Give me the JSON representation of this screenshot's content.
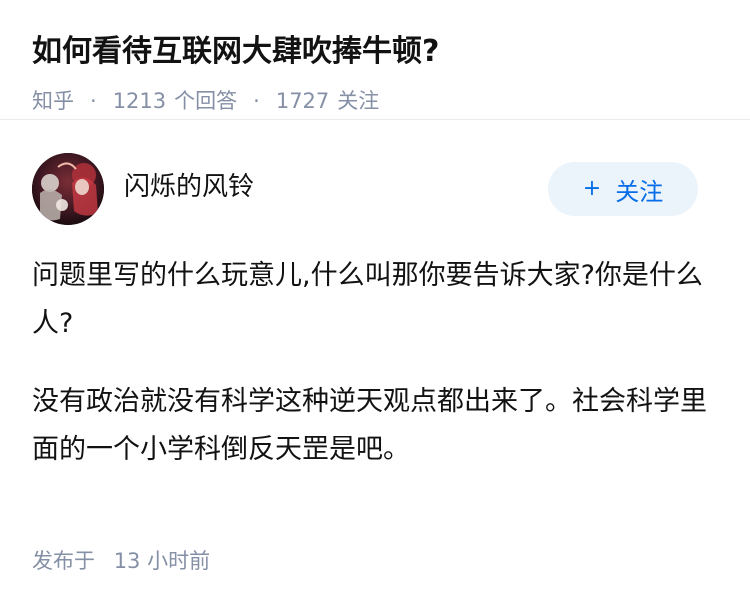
{
  "question": {
    "title": "如何看待互联网大肆吹捧牛顿?",
    "source": "知乎",
    "answer_count": "1213",
    "answer_label": "个回答",
    "follower_count": "1727",
    "follower_label": "关注",
    "separator": "·"
  },
  "answer": {
    "author_name": "闪烁的风铃",
    "follow_button": {
      "plus": "+",
      "label": "关注"
    },
    "paragraphs": [
      "问题里写的什么玩意儿,什么叫那你要告诉大家?你是什么人?",
      "没有政治就没有科学这种逆天观点都出来了。社会科学里面的一个小学科倒反天罡是吧。"
    ],
    "time_label": "发布于",
    "time_value": "13 小时前"
  },
  "colors": {
    "meta": "#8590a6",
    "accent": "#056de8",
    "follow_bg": "#ebf3fb"
  }
}
